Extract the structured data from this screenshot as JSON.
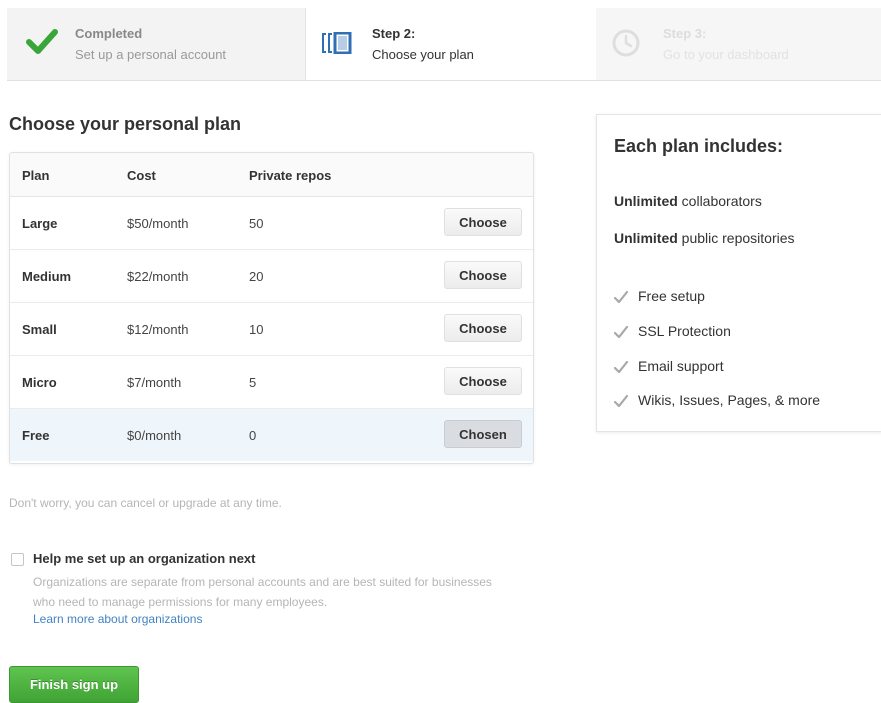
{
  "steps": [
    {
      "title": "Completed",
      "subtitle": "Set up a personal account",
      "state": "completed",
      "icon": "check-icon"
    },
    {
      "title": "Step 2:",
      "subtitle": "Choose your plan",
      "state": "current",
      "icon": "repo-icon"
    },
    {
      "title": "Step 3:",
      "subtitle": "Go to your dashboard",
      "state": "upcoming",
      "icon": "clock-icon"
    }
  ],
  "plans": {
    "heading": "Choose your personal plan",
    "columns": {
      "plan": "Plan",
      "cost": "Cost",
      "repos": "Private repos"
    },
    "rows": [
      {
        "name": "Large",
        "cost": "$50/month",
        "repos": "50",
        "button": "Choose"
      },
      {
        "name": "Medium",
        "cost": "$22/month",
        "repos": "20",
        "button": "Choose"
      },
      {
        "name": "Small",
        "cost": "$12/month",
        "repos": "10",
        "button": "Choose"
      },
      {
        "name": "Micro",
        "cost": "$7/month",
        "repos": "5",
        "button": "Choose"
      },
      {
        "name": "Free",
        "cost": "$0/month",
        "repos": "0",
        "button": "Chosen"
      }
    ],
    "selected_plan": "Free"
  },
  "includes": {
    "title": "Each plan includes:",
    "line1_bold": "Unlimited",
    "line1_rest": " collaborators",
    "line2_bold": "Unlimited",
    "line2_rest": " public repositories",
    "features": [
      "Free setup",
      "SSL Protection",
      "Email support",
      "Wikis, Issues, Pages, & more"
    ]
  },
  "note": "Don't worry, you can cancel or upgrade at any time.",
  "organization": {
    "checkbox_label": "Help me set up an organization next",
    "checked": false,
    "description": "Organizations are separate from personal accounts and are best suited for businesses who need to manage permissions for many employees.",
    "link": "Learn more about organizations"
  },
  "finish_button": "Finish sign up",
  "colors": {
    "accent_green": "#40a335",
    "link_blue": "#4183c4",
    "selected_row": "#eef5fb",
    "check_green": "#3aa63a",
    "repo_blue": "#2f6fb4"
  }
}
